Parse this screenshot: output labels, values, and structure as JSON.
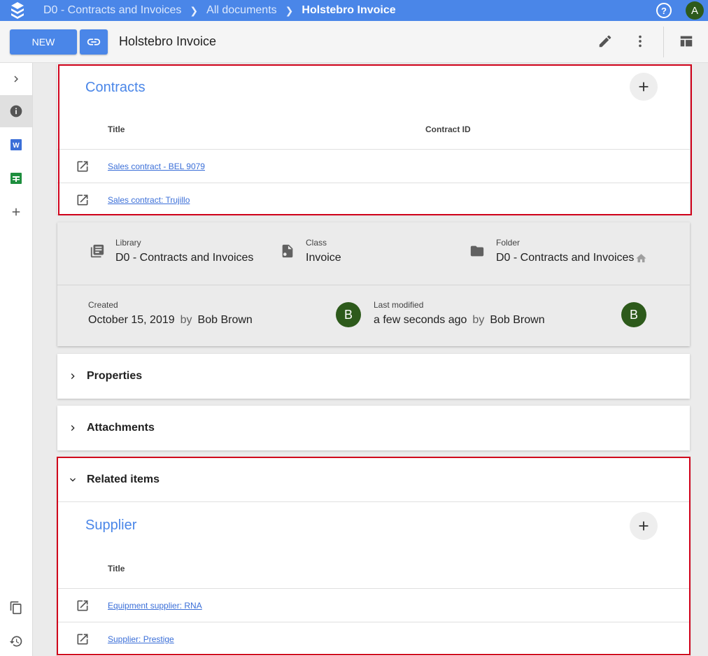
{
  "topbar": {
    "breadcrumbs": [
      "D0 - Contracts and Invoices",
      "All documents",
      "Holstebro Invoice"
    ],
    "avatar_initial": "A",
    "help_icon": "help-circle-icon"
  },
  "toolbar": {
    "new_label": "NEW",
    "title": "Holstebro Invoice"
  },
  "contracts": {
    "title": "Contracts",
    "columns": [
      "Title",
      "Contract ID"
    ],
    "rows": [
      {
        "title": "Sales contract - BEL 9079",
        "contract_id": ""
      },
      {
        "title": "Sales contract: Trujillo",
        "contract_id": ""
      }
    ]
  },
  "info": {
    "library_label": "Library",
    "library_value": "D0 - Contracts and Invoices",
    "class_label": "Class",
    "class_value": "Invoice",
    "folder_label": "Folder",
    "folder_value": "D0 - Contracts and Invoices",
    "created_label": "Created",
    "created_date": "October 15, 2019",
    "by": "by",
    "created_by": "Bob Brown",
    "created_avatar": "B",
    "modified_label": "Last modified",
    "modified_date": "a few seconds ago",
    "modified_by": "Bob Brown",
    "modified_avatar": "B"
  },
  "sections": {
    "properties": "Properties",
    "attachments": "Attachments",
    "related": "Related items"
  },
  "supplier": {
    "title": "Supplier",
    "columns": [
      "Title"
    ],
    "rows": [
      {
        "title": "Equipment supplier: RNA"
      },
      {
        "title": "Supplier: Prestige"
      }
    ]
  },
  "colors": {
    "accent": "#4a86e8",
    "highlight_border": "#d0021b",
    "avatar": "#2d5a1b"
  }
}
